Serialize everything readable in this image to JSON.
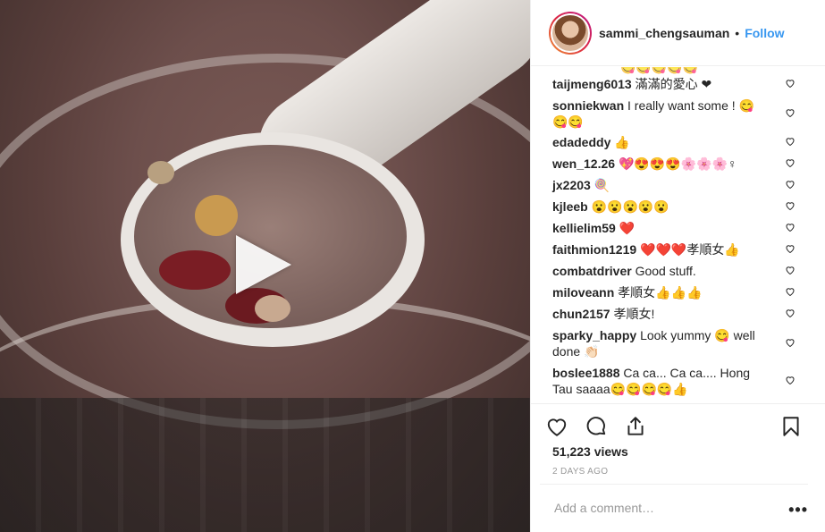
{
  "post": {
    "username": "sammi_chengsauman",
    "separator": "•",
    "follow_label": "Follow",
    "views": "51,223 views",
    "time": "2 DAYS AGO",
    "comment_placeholder": "Add a comment…",
    "more_label": "•••"
  },
  "comments": [
    {
      "user": "taijmeng6013",
      "text": "滿滿的愛心 ❤"
    },
    {
      "user": "sonniekwan",
      "text": "I really want some ! 😋",
      "text2": "😋😋"
    },
    {
      "user": "edadeddy",
      "text": "👍"
    },
    {
      "user": "wen_12.26",
      "text": "💖😍😍😍🌸🌸🌸♀"
    },
    {
      "user": "jx2203",
      "text": "🍭"
    },
    {
      "user": "kjleeb",
      "text": "😮😮😮😮😮"
    },
    {
      "user": "kellielim59",
      "text": "❤️"
    },
    {
      "user": "faithmion1219",
      "text": "❤️❤️❤️孝順女👍"
    },
    {
      "user": "combatdriver",
      "text": "Good stuff."
    },
    {
      "user": "miloveann",
      "text": "孝順女👍👍👍"
    },
    {
      "user": "chun2157",
      "text": "孝順女!"
    },
    {
      "user": "sparky_happy",
      "text": "Look yummy 😋 well",
      "text2": "done 👏🏻"
    },
    {
      "user": "boslee1888",
      "text": "Ca ca... Ca ca.... Hong",
      "text2": "Tau saaaa😋😋😋😋👍"
    }
  ],
  "icons": {
    "like": "heart-icon",
    "comment": "comment-icon",
    "share": "share-icon",
    "save": "bookmark-icon",
    "play": "play-icon"
  },
  "colors": {
    "accent": "#3897f0",
    "text": "#262626",
    "muted": "#999999",
    "border": "#efefef"
  }
}
